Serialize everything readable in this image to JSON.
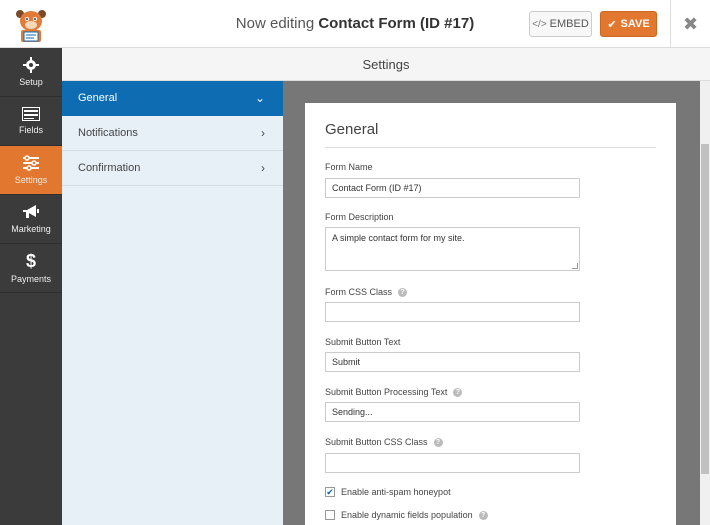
{
  "header": {
    "title_prefix": "Now editing ",
    "form_title": "Contact Form (ID #17)",
    "embed_label": "EMBED",
    "save_label": "SAVE",
    "close_icon": "close-icon"
  },
  "leftnav": {
    "items": [
      {
        "label": "Setup",
        "icon": "gear-icon",
        "active": false
      },
      {
        "label": "Fields",
        "icon": "list-icon",
        "active": false
      },
      {
        "label": "Settings",
        "icon": "sliders-icon",
        "active": true
      },
      {
        "label": "Marketing",
        "icon": "megaphone-icon",
        "active": false
      },
      {
        "label": "Payments",
        "icon": "dollar-icon",
        "active": false
      }
    ]
  },
  "settings_header": "Settings",
  "panel": {
    "items": [
      {
        "label": "General",
        "active": true
      },
      {
        "label": "Notifications",
        "active": false
      },
      {
        "label": "Confirmation",
        "active": false
      }
    ]
  },
  "general": {
    "heading": "General",
    "form_name_label": "Form Name",
    "form_name_value": "Contact Form (ID #17)",
    "form_description_label": "Form Description",
    "form_description_value": "A simple contact form for my site.",
    "form_css_class_label": "Form CSS Class",
    "form_css_class_value": "",
    "submit_text_label": "Submit Button Text",
    "submit_text_value": "Submit",
    "submit_processing_label": "Submit Button Processing Text",
    "submit_processing_value": "Sending...",
    "submit_css_label": "Submit Button CSS Class",
    "submit_css_value": "",
    "honeypot_label": "Enable anti-spam honeypot",
    "honeypot_checked": true,
    "dynamic_fields_label": "Enable dynamic fields population",
    "dynamic_fields_checked": false
  },
  "colors": {
    "accent_orange": "#e27730",
    "accent_blue": "#0e6cb3",
    "nav_dark": "#3b3b3b"
  }
}
